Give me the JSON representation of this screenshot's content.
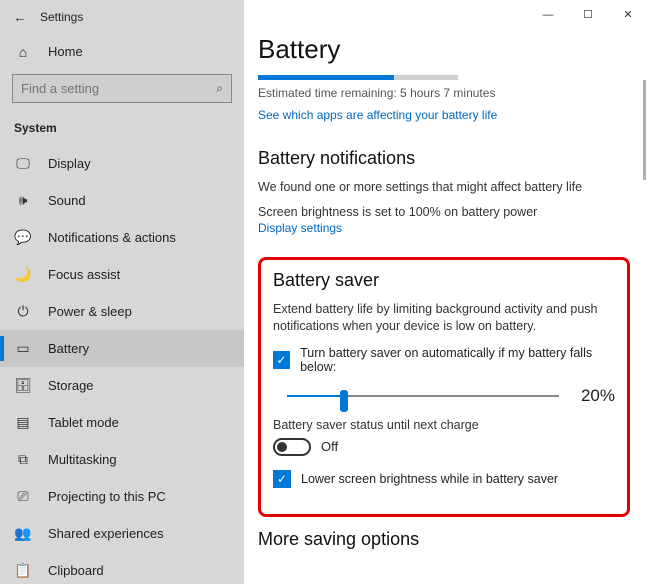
{
  "window": {
    "title": "Settings"
  },
  "home": {
    "label": "Home"
  },
  "search": {
    "placeholder": "Find a setting"
  },
  "section": "System",
  "nav": [
    {
      "icon": "🖵",
      "label": "Display"
    },
    {
      "icon": "🕪",
      "label": "Sound"
    },
    {
      "icon": "💬",
      "label": "Notifications & actions"
    },
    {
      "icon": "🌙",
      "label": "Focus assist"
    },
    {
      "icon": "⏻",
      "label": "Power & sleep"
    },
    {
      "icon": "▭",
      "label": "Battery"
    },
    {
      "icon": "🗄",
      "label": "Storage"
    },
    {
      "icon": "▤",
      "label": "Tablet mode"
    },
    {
      "icon": "⧉",
      "label": "Multitasking"
    },
    {
      "icon": "⎚",
      "label": "Projecting to this PC"
    },
    {
      "icon": "👥",
      "label": "Shared experiences"
    },
    {
      "icon": "📋",
      "label": "Clipboard"
    }
  ],
  "page": {
    "title": "Battery",
    "progressPct": 68,
    "estimated": "Estimated time remaining: 5 hours 7 minutes",
    "appsLink": "See which apps are affecting your battery life",
    "notifHeading": "Battery notifications",
    "notifBody": "We found one or more settings that might affect battery life",
    "brightnessNote": "Screen brightness is set to 100% on battery power",
    "displayLink": "Display settings",
    "saverHeading": "Battery saver",
    "saverBody": "Extend battery life by limiting background activity and push notifications when your device is low on battery.",
    "autoCheck": "Turn battery saver on automatically if my battery falls below:",
    "sliderPct": 20,
    "sliderLabel": "20%",
    "statusLabel": "Battery saver status until next charge",
    "toggleState": "Off",
    "lowerCheck": "Lower screen brightness while in battery saver",
    "moreHeading": "More saving options"
  }
}
